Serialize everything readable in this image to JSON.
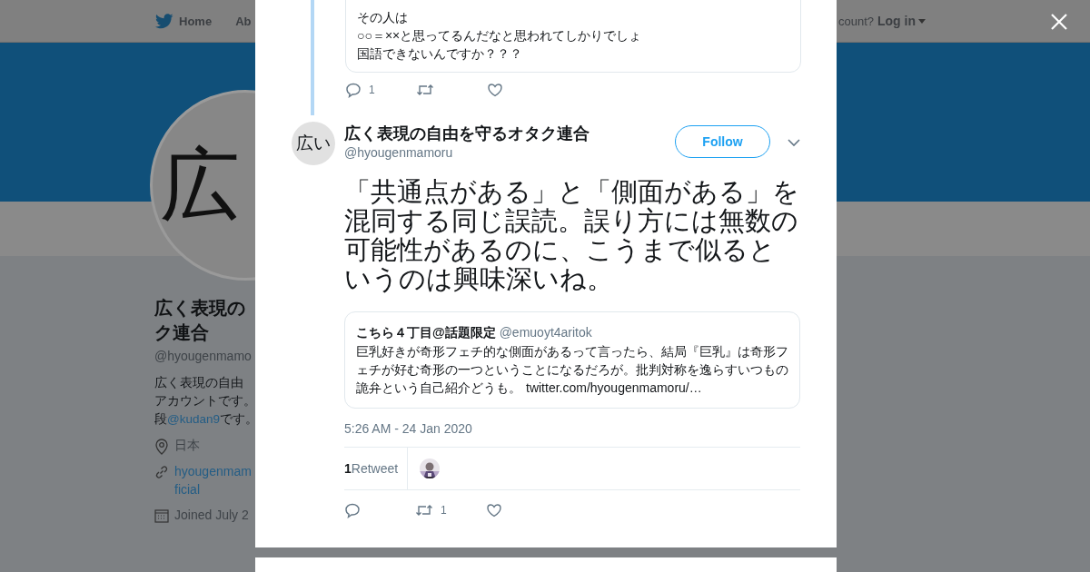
{
  "page": {
    "nav": [
      {
        "label": "Home"
      },
      {
        "label": "Ab"
      }
    ],
    "login_prompt": "count?",
    "login": "Log in",
    "profile": {
      "avatar_text": "広",
      "name_lines": [
        "広く表現の",
        "ク連合"
      ],
      "handle": "@hyougenmamo",
      "bio": [
        {
          "text": "広く表現の自由"
        },
        {
          "text": "アカウントです。"
        },
        {
          "before": "段",
          "link": "@kudan9",
          "after": "です。"
        }
      ],
      "location": "日本",
      "website": [
        "hyougenmam",
        "ficial"
      ],
      "joined": "Joined July 2"
    }
  },
  "modal": {
    "thread_card": {
      "lines": [
        "その人は",
        "○○＝××と思ってるんだなと思われてしかりでしょ",
        "国語できないんですか？？？"
      ]
    },
    "thread_actions": {
      "reply": "1"
    },
    "tweet": {
      "avatar_text": "広い",
      "name": "広く表現の自由を守るオタク連合",
      "handle": "@hyougenmamoru",
      "follow": "Follow",
      "text": "「共通点がある」と「側面がある」を混同する同じ誤読。誤り方には無数の可能性があるのに、こうまで似るというのは興味深いね。",
      "quote": {
        "name": "こちら４丁目@話題限定",
        "handle": "@emuoyt4aritok",
        "text": "巨乳好きが奇形フェチ的な側面があるって言ったら、結局『巨乳』は奇形フェチが好む奇形の一つということになるだろが。批判対称を逸らすいつもの詭弁という自己紹介どうも。",
        "link": "twitter.com/hyougenmamoru/…"
      },
      "time": "5:26 AM - 24 Jan 2020",
      "retweets": {
        "count": "1",
        "label": "Retweet"
      },
      "actions": {
        "retweet": "1"
      }
    }
  }
}
